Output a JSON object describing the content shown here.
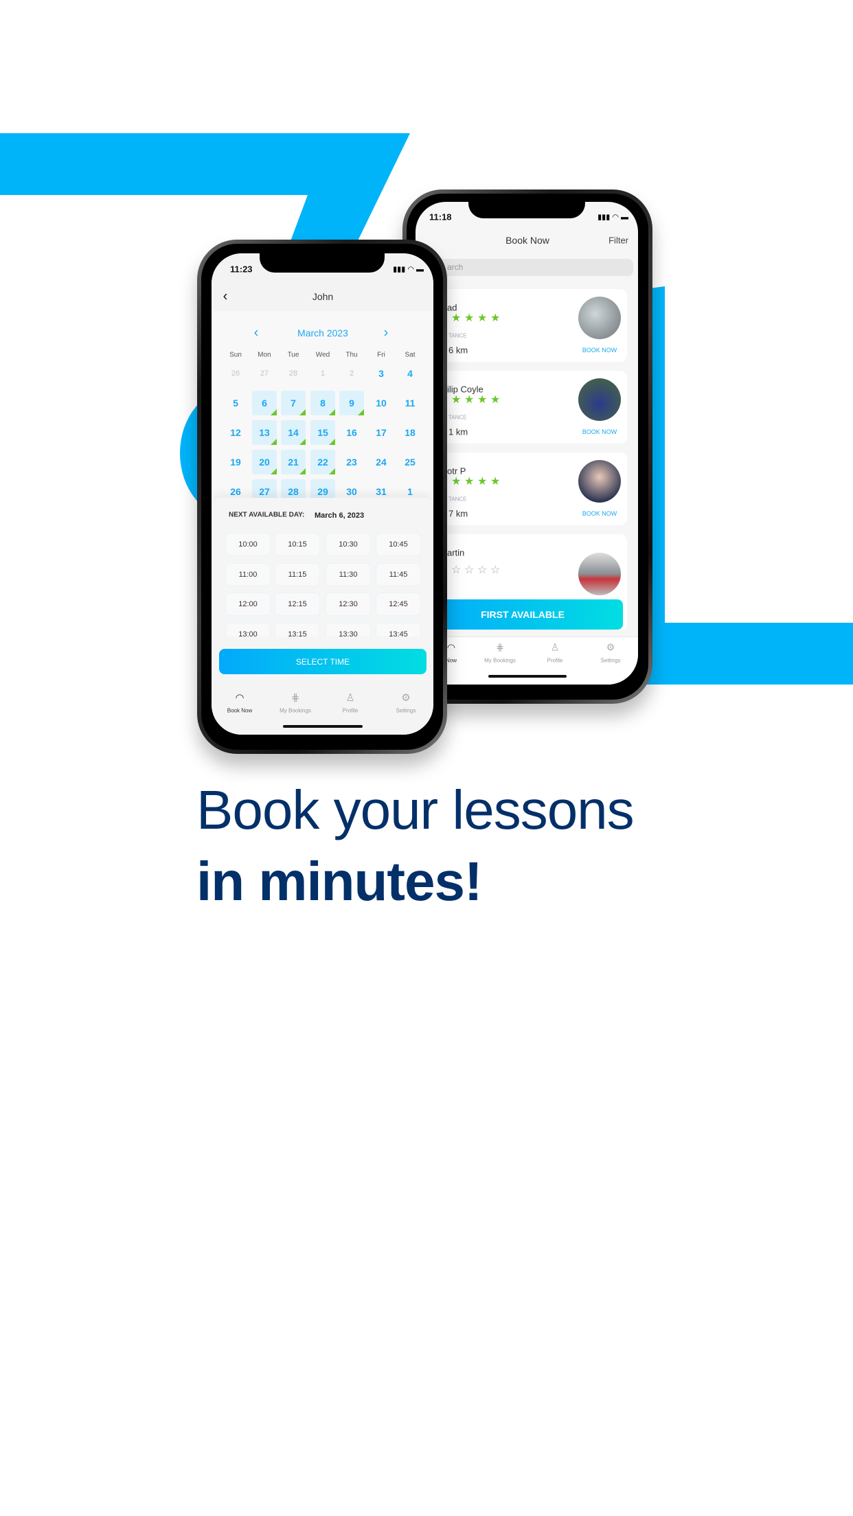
{
  "colors": {
    "brand_blue": "#00b4fa",
    "heading": "#033069",
    "accent": "#1ba8f2",
    "available_marker": "#6cc72a"
  },
  "headline": {
    "line1": "Book your lessons",
    "line2": "in minutes!"
  },
  "calendar_phone": {
    "status_time": "11:23",
    "header_title": "John",
    "back_icon": "chevron-left-icon",
    "month_label": "March 2023",
    "weekdays": [
      "Sun",
      "Mon",
      "Tue",
      "Wed",
      "Thu",
      "Fri",
      "Sat"
    ],
    "weeks": [
      [
        {
          "d": "26",
          "s": "muted"
        },
        {
          "d": "27",
          "s": "muted"
        },
        {
          "d": "28",
          "s": "muted"
        },
        {
          "d": "1",
          "s": "muted"
        },
        {
          "d": "2",
          "s": "muted"
        },
        {
          "d": "3",
          "s": ""
        },
        {
          "d": "4",
          "s": ""
        }
      ],
      [
        {
          "d": "5",
          "s": ""
        },
        {
          "d": "6",
          "s": "avail"
        },
        {
          "d": "7",
          "s": "avail"
        },
        {
          "d": "8",
          "s": "avail"
        },
        {
          "d": "9",
          "s": "avail"
        },
        {
          "d": "10",
          "s": ""
        },
        {
          "d": "11",
          "s": ""
        }
      ],
      [
        {
          "d": "12",
          "s": ""
        },
        {
          "d": "13",
          "s": "avail"
        },
        {
          "d": "14",
          "s": "avail"
        },
        {
          "d": "15",
          "s": "avail"
        },
        {
          "d": "16",
          "s": ""
        },
        {
          "d": "17",
          "s": ""
        },
        {
          "d": "18",
          "s": ""
        }
      ],
      [
        {
          "d": "19",
          "s": ""
        },
        {
          "d": "20",
          "s": "avail"
        },
        {
          "d": "21",
          "s": "avail"
        },
        {
          "d": "22",
          "s": "avail"
        },
        {
          "d": "23",
          "s": ""
        },
        {
          "d": "24",
          "s": ""
        },
        {
          "d": "25",
          "s": ""
        }
      ],
      [
        {
          "d": "26",
          "s": ""
        },
        {
          "d": "27",
          "s": "avail"
        },
        {
          "d": "28",
          "s": "avail"
        },
        {
          "d": "29",
          "s": "avail"
        },
        {
          "d": "30",
          "s": ""
        },
        {
          "d": "31",
          "s": ""
        },
        {
          "d": "1",
          "s": ""
        }
      ]
    ],
    "next_available_label": "NEXT AVAILABLE DAY:",
    "next_available_value": "March 6, 2023",
    "time_slots": [
      "10:00",
      "10:15",
      "10:30",
      "10:45",
      "11:00",
      "11:15",
      "11:30",
      "11:45",
      "12:00",
      "12:15",
      "12:30",
      "12:45",
      "13:00",
      "13:15",
      "13:30",
      "13:45"
    ],
    "select_button": "SELECT TIME",
    "nav": [
      {
        "label": "Book Now",
        "icon": "speedometer-icon",
        "active": true
      },
      {
        "label": "My Bookings",
        "icon": "gear-shift-icon"
      },
      {
        "label": "Profile",
        "icon": "person-icon"
      },
      {
        "label": "Settings",
        "icon": "gear-icon"
      }
    ]
  },
  "list_phone": {
    "status_time": "11:18",
    "header_title": "Book Now",
    "filter_label": "Filter",
    "search_placeholder": "arch",
    "instructors": [
      {
        "name": "ad",
        "rating_stars": 5,
        "distance_label": "TANCE",
        "distance": "6 km",
        "book": "BOOK NOW"
      },
      {
        "name": "ilip Coyle",
        "rating_stars": 5,
        "distance_label": "TANCE",
        "distance": "1 km",
        "book": "BOOK NOW"
      },
      {
        "name": "otr P",
        "rating_stars": 5,
        "distance_label": "TANCE",
        "distance": "7 km",
        "book": "BOOK NOW"
      },
      {
        "name": "artin",
        "rating_stars": 0
      }
    ],
    "first_available_button": "FIRST AVAILABLE",
    "nav": [
      {
        "label": "Now",
        "icon": "speedometer-icon"
      },
      {
        "label": "My Bookings",
        "icon": "gear-shift-icon"
      },
      {
        "label": "Profile",
        "icon": "person-icon"
      },
      {
        "label": "Settings",
        "icon": "gear-icon"
      }
    ]
  }
}
